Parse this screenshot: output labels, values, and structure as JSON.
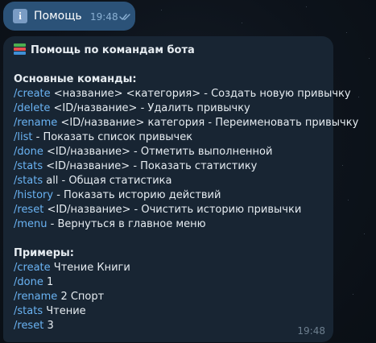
{
  "outgoing": {
    "icon": "info-icon",
    "text": "Помощь",
    "time": "19:48",
    "status": "read-double-check"
  },
  "help_message": {
    "icon": "books-icon",
    "title": "Помощь по командам бота",
    "section_commands": "Основные команды:",
    "commands": [
      {
        "cmd": "/create",
        "rest": " <название> <категория> - Создать новую привычку"
      },
      {
        "cmd": "/delete",
        "rest": " <ID/название> - Удалить привычку"
      },
      {
        "cmd": "/rename",
        "rest": " <ID/название> категория - Переименовать привычку"
      },
      {
        "cmd": "/list",
        "rest": " - Показать список привычек"
      },
      {
        "cmd": "/done",
        "rest": " <ID/название> - Отметить выполненной"
      },
      {
        "cmd": "/stats",
        "rest": " <ID/название> - Показать статистику"
      },
      {
        "cmd": "/stats",
        "rest": " all - Общая статистика"
      },
      {
        "cmd": "/history",
        "rest": " - Показать историю действий"
      },
      {
        "cmd": "/reset",
        "rest": " <ID/название> - Очистить историю привычки"
      },
      {
        "cmd": "/menu",
        "rest": " - Вернуться в главное меню"
      }
    ],
    "section_examples": "Примеры:",
    "examples": [
      {
        "cmd": "/create",
        "rest": " Чтение Книги"
      },
      {
        "cmd": "/done",
        "rest": " 1"
      },
      {
        "cmd": "/rename",
        "rest": " 2 Спорт"
      },
      {
        "cmd": "/stats",
        "rest": " Чтение"
      },
      {
        "cmd": "/reset",
        "rest": " 3"
      }
    ],
    "time": "19:48"
  },
  "colors": {
    "background": "#0d131b",
    "outgoing_bubble": "#2b5278",
    "incoming_bubble": "#182533",
    "command_link": "#6ab3f3",
    "text": "#e6ecf1"
  }
}
